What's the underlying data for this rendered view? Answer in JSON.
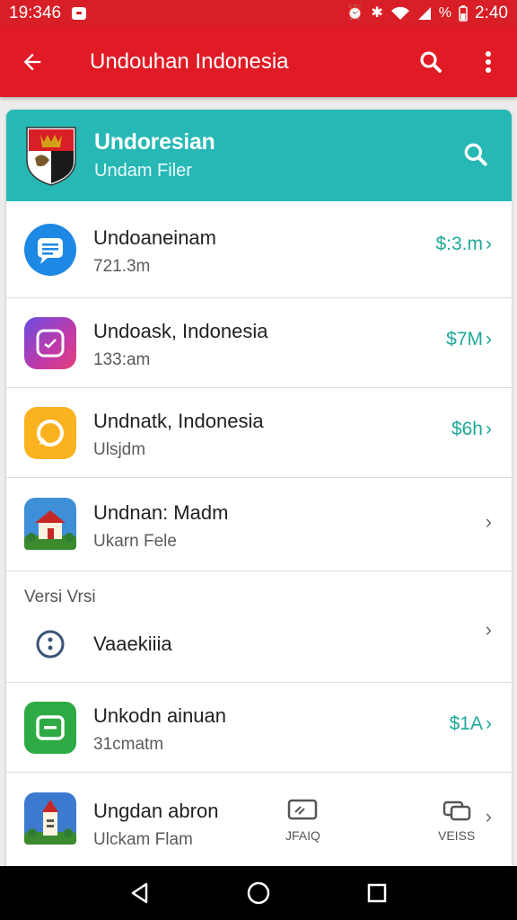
{
  "status_bar": {
    "time_left": "19:346",
    "time_right": "2:40",
    "battery_text": "%"
  },
  "app_bar": {
    "title": "Undouhan Indonesia",
    "icons": [
      "back-arrow-icon",
      "search-icon",
      "more-vert-icon"
    ]
  },
  "card_header": {
    "title": "Undoresian",
    "subtitle": "Undam Filer",
    "icon": "search-icon"
  },
  "rows": [
    {
      "name": "Undoaneinam",
      "sub": "721.3m",
      "price": "$:3.m",
      "icon": "chat-bubble-icon",
      "color": "#1e88e5"
    },
    {
      "name": "Undoask, Indonesia",
      "sub": "133:am",
      "price": "$7M",
      "icon": "instagram-icon",
      "color": "#c13aa8"
    },
    {
      "name": "Undnatk, Indonesia",
      "sub": "Ulsjdm",
      "price": "$6h",
      "icon": "chat-ring-icon",
      "color": "#fbb21f"
    },
    {
      "name": "Undnan: Madm",
      "sub": "Ukarn Fele",
      "price": "",
      "icon": "house-icon",
      "color": "#3f8fd8"
    }
  ],
  "section": {
    "label": "Versi Vrsi",
    "item_name": "Vaaekiiia",
    "item_icon": "info-dots-icon"
  },
  "rows2": [
    {
      "name": "Unkodn ainuan",
      "sub": "31cmatm",
      "price": "$1A",
      "icon": "chat-square-icon",
      "color": "#2eaa45"
    },
    {
      "name": "Ungdan abron",
      "sub": "Ulckam Flam",
      "price": "",
      "icon": "church-icon",
      "color": "#3d7bd0"
    }
  ],
  "bottom_actions": [
    {
      "label": "JFAIQ",
      "icon": "cast-icon"
    },
    {
      "label": "VEISS",
      "icon": "copy-icon"
    }
  ],
  "nav": [
    "back-triangle-icon",
    "home-circle-icon",
    "recents-square-icon"
  ]
}
